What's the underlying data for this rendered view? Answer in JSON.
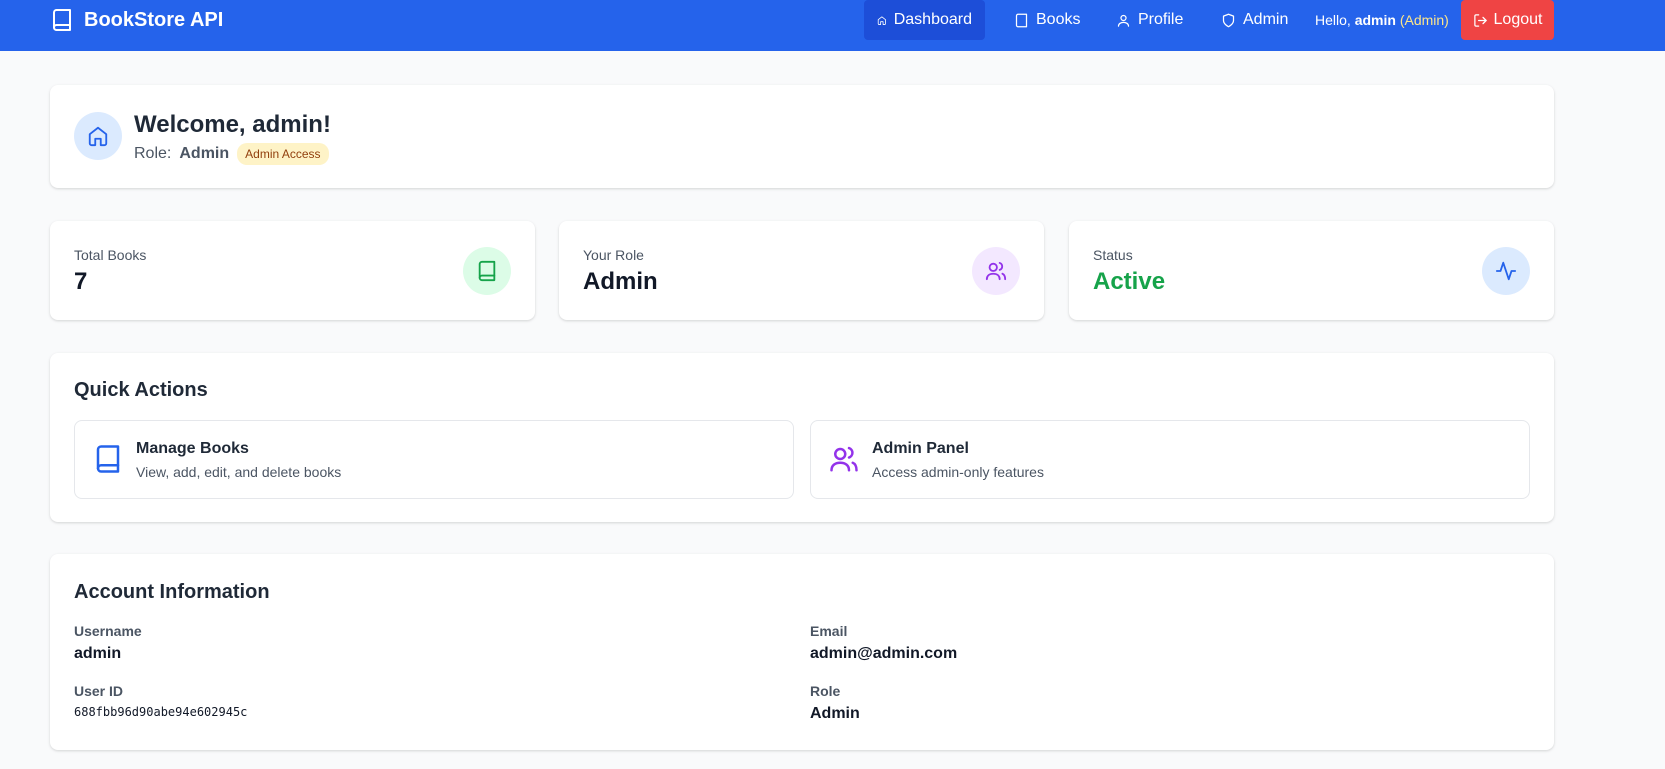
{
  "navbar": {
    "brand": "BookStore API",
    "items": [
      {
        "label": "Dashboard",
        "icon": "home-icon"
      },
      {
        "label": "Books",
        "icon": "book-icon"
      },
      {
        "label": "Profile",
        "icon": "user-icon"
      },
      {
        "label": "Admin",
        "icon": "shield-icon"
      }
    ],
    "hello_prefix": "Hello,",
    "hello_user": "admin",
    "hello_role": "(Admin)",
    "logout": "Logout"
  },
  "welcome": {
    "title": "Welcome, admin!",
    "role_prefix": "Role:",
    "role_value": "Admin",
    "badge": "Admin Access"
  },
  "stats": [
    {
      "label": "Total Books",
      "value": "7",
      "icon": "book-icon",
      "icon_bg": "#dcfce7",
      "icon_color": "#16a34a",
      "value_color": "#111827"
    },
    {
      "label": "Your Role",
      "value": "Admin",
      "icon": "users-icon",
      "icon_bg": "#f3e8ff",
      "icon_color": "#9333ea",
      "value_color": "#111827"
    },
    {
      "label": "Status",
      "value": "Active",
      "icon": "activity-icon",
      "icon_bg": "#dbeafe",
      "icon_color": "#2563eb",
      "value_color": "#16a34a"
    }
  ],
  "quick_actions": {
    "title": "Quick Actions",
    "items": [
      {
        "title": "Manage Books",
        "desc": "View, add, edit, and delete books",
        "icon": "book-icon",
        "color": "#2563eb"
      },
      {
        "title": "Admin Panel",
        "desc": "Access admin-only features",
        "icon": "users-icon",
        "color": "#9333ea"
      }
    ]
  },
  "account": {
    "title": "Account Information",
    "username_label": "Username",
    "username": "admin",
    "email_label": "Email",
    "email": "admin@admin.com",
    "user_id_label": "User ID",
    "user_id": "688fbb96d90abe94e602945c",
    "role_label": "Role",
    "role": "Admin"
  },
  "colors": {
    "primary": "#2563eb",
    "primary_dark": "#1d4ed8",
    "danger": "#ef4444",
    "success": "#16a34a",
    "purple": "#9333ea"
  }
}
